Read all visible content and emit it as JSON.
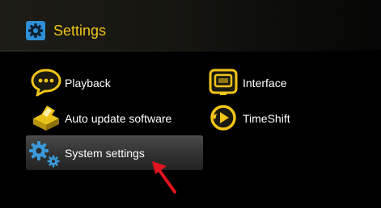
{
  "header": {
    "title": "Settings",
    "icon": "gear-icon"
  },
  "menu": {
    "items": [
      {
        "label": "Playback",
        "icon": "speech-bubble-icon"
      },
      {
        "label": "Interface",
        "icon": "screen-icon"
      },
      {
        "label": "Auto update software",
        "icon": "receiver-box-icon"
      },
      {
        "label": "TimeShift",
        "icon": "timeshift-icon"
      },
      {
        "label": "System settings",
        "icon": "gears-icon"
      }
    ],
    "selected": "System settings"
  },
  "colors": {
    "accent": "#f0c419",
    "icon_blue": "#3a9ad9",
    "arrow": "#e0141e",
    "background": "#000000"
  }
}
